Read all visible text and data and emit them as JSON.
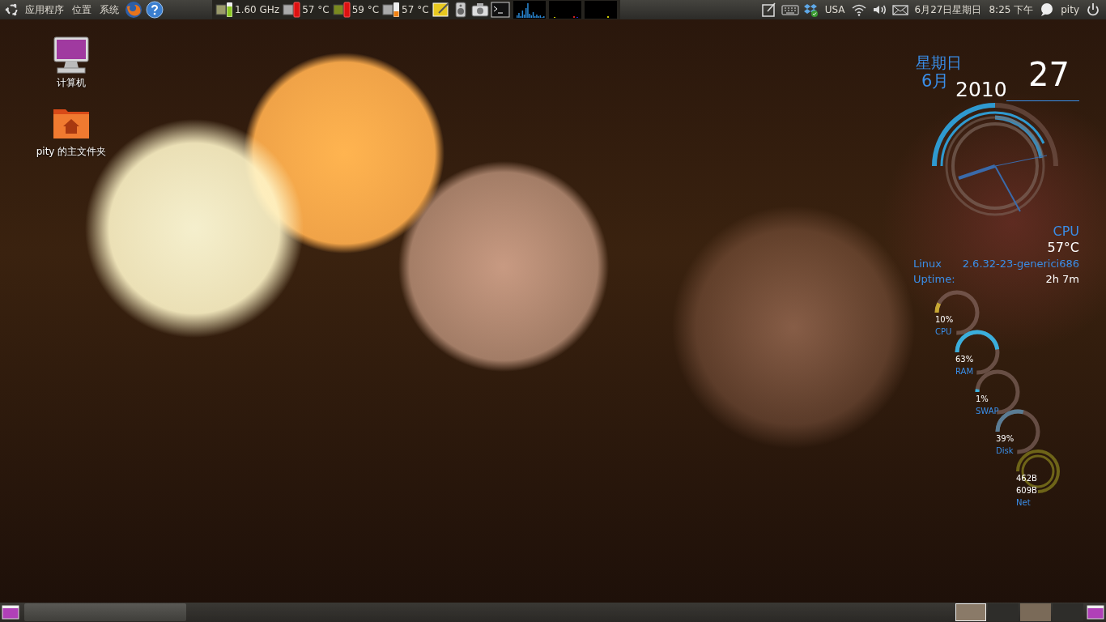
{
  "top_panel": {
    "menus": [
      {
        "label": "应用程序"
      },
      {
        "label": "位置"
      },
      {
        "label": "系统"
      }
    ],
    "sensors": [
      {
        "kind": "freq",
        "reading": "1.60 GHz"
      },
      {
        "kind": "temp_red",
        "reading": "57 °C"
      },
      {
        "kind": "temp_green",
        "reading": "59 °C"
      },
      {
        "kind": "temp_low",
        "reading": "57 °C"
      }
    ],
    "layout": "USA",
    "clock": {
      "date": "6月27日星期日",
      "time": "8:25 下午"
    },
    "user": "pity"
  },
  "desktop_icons": [
    {
      "kind": "computer",
      "label": "计算机"
    },
    {
      "kind": "home",
      "label": "pity 的主文件夹"
    }
  ],
  "conky": {
    "weekday": "星期日",
    "month": "6月",
    "year": "2010",
    "day": "27",
    "cpu_label": "CPU",
    "cpu_temp": "57°C",
    "os_label": "Linux",
    "kernel": "2.6.32-23-generici686",
    "uptime_label": "Uptime:",
    "uptime": "2h 7m",
    "gauges": [
      {
        "kind": "arc",
        "values": [
          "10%"
        ],
        "label": "CPU",
        "level": 0.1,
        "color": "#c8a832"
      },
      {
        "kind": "arc",
        "values": [
          "63%"
        ],
        "label": "RAM",
        "level": 0.63,
        "color": "#3aaedc"
      },
      {
        "kind": "arc",
        "values": [
          "1%"
        ],
        "label": "SWAP",
        "level": 0.01,
        "color": "#3aaedc"
      },
      {
        "kind": "arc",
        "values": [
          "39%"
        ],
        "label": "Disk",
        "level": 0.39,
        "color": "#5a7c94"
      },
      {
        "kind": "rings",
        "values": [
          "462B",
          "609B"
        ],
        "label": "Net",
        "color": "#6e6418"
      }
    ]
  },
  "bottom_panel": {
    "workspaces": [
      {
        "selected": true
      },
      {
        "selected": false
      },
      {
        "selected": false
      },
      {
        "selected": false
      }
    ]
  }
}
